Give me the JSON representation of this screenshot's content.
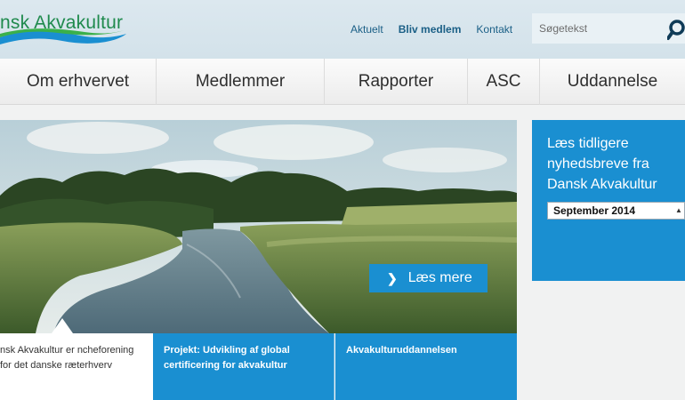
{
  "header": {
    "logo_text": "nsk Akvakultur",
    "topnav": [
      {
        "label": "Aktuelt",
        "bold": false
      },
      {
        "label": "Bliv medlem",
        "bold": true
      },
      {
        "label": "Kontakt",
        "bold": false
      }
    ],
    "search_placeholder": "Søgetekst"
  },
  "mainnav": [
    {
      "label": "Om erhvervet"
    },
    {
      "label": "Medlemmer"
    },
    {
      "label": "Rapporter"
    },
    {
      "label": "ASC"
    },
    {
      "label": "Uddannelse"
    }
  ],
  "hero": {
    "read_more_label": "Læs mere"
  },
  "tiles": [
    {
      "text": "nsk Akvakultur er ncheforening for det danske ræterhverv"
    },
    {
      "text": "Projekt: Udvikling af global certificering for akvakultur"
    },
    {
      "text": "Akvakulturuddannelsen"
    }
  ],
  "newsletter": {
    "title": "Læs tidligere nyhedsbreve fra Dansk Akvakultur",
    "selected": "September 2014"
  },
  "colors": {
    "accent": "#1a8fd1",
    "logo_green": "#1f8a4d",
    "nav_link": "#1a5f86"
  }
}
